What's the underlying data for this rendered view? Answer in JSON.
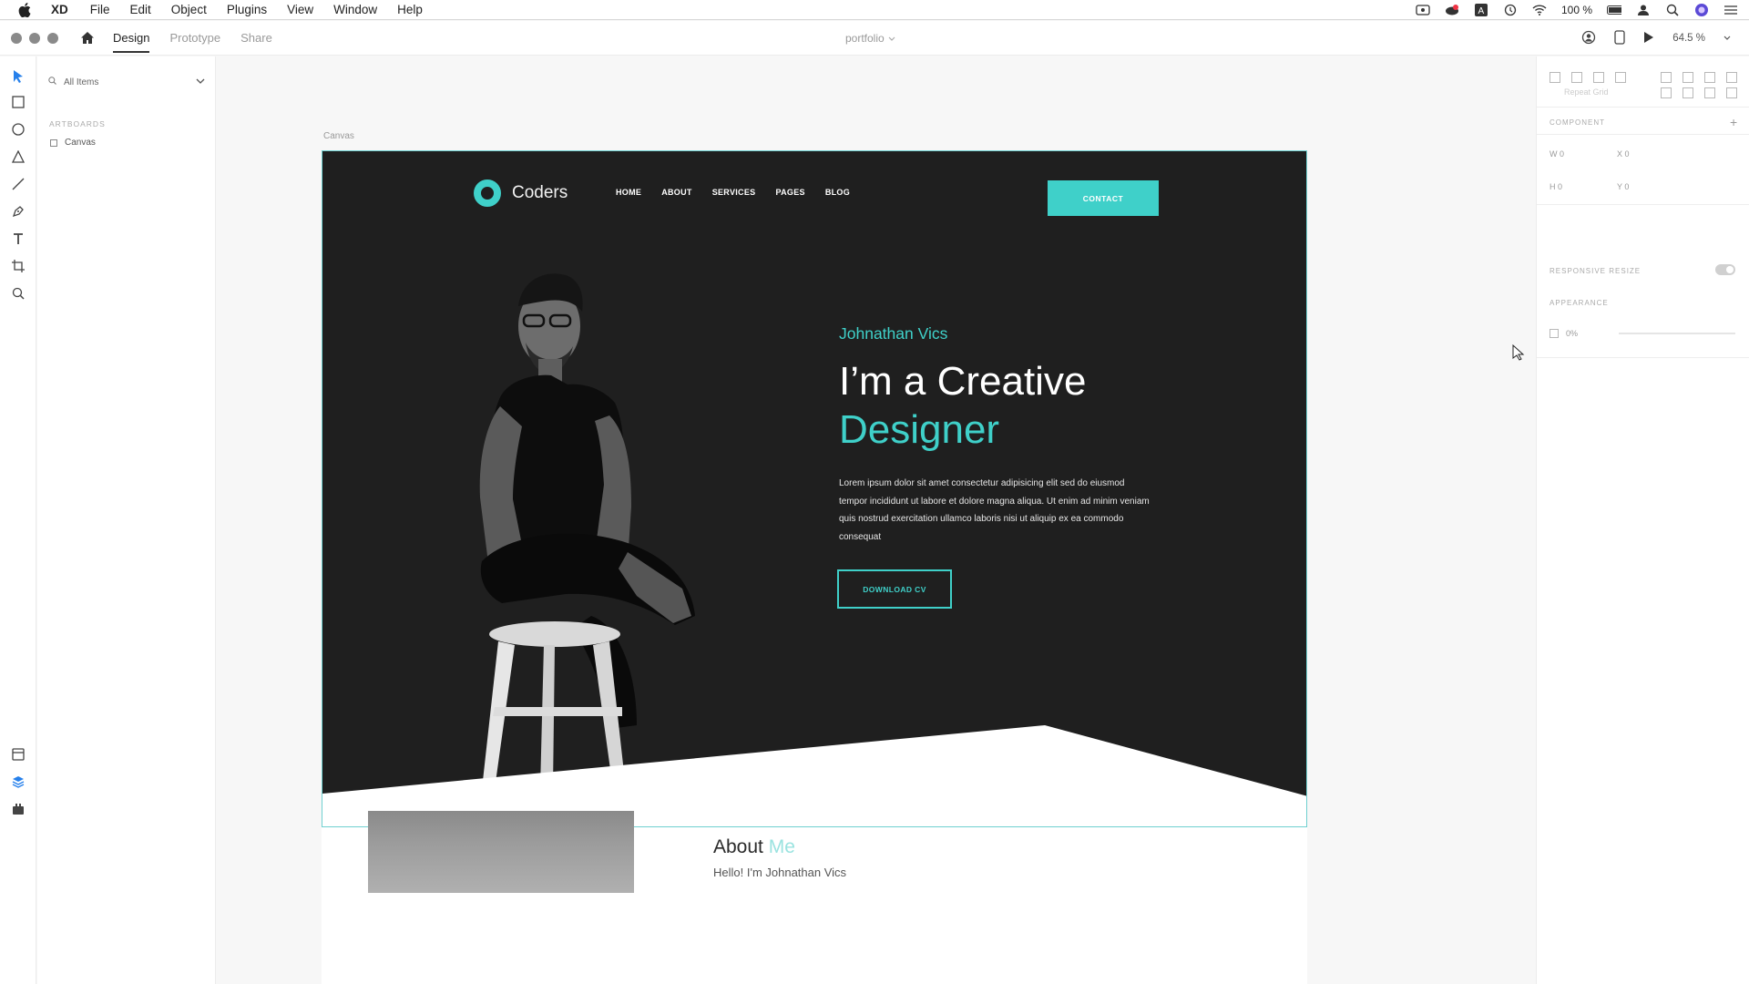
{
  "menubar": {
    "app": "XD",
    "items": [
      "File",
      "Edit",
      "Object",
      "Plugins",
      "View",
      "Window",
      "Help"
    ],
    "status": {
      "battery": "100 %"
    }
  },
  "titlebar": {
    "tabs": [
      "Design",
      "Prototype",
      "Share"
    ],
    "active_tab": "Design",
    "document": "portfolio",
    "zoom": "64.5 %"
  },
  "layers": {
    "search_placeholder": "All Items",
    "section": "ARTBOARDS",
    "items": [
      "Canvas"
    ]
  },
  "canvas": {
    "artboard_label": "Canvas",
    "nav": {
      "brand": "Coders",
      "links": [
        "HOME",
        "ABOUT",
        "SERVICES",
        "PAGES",
        "BLOG"
      ],
      "contact": "CONTACT"
    },
    "hero": {
      "name": "Johnathan Vics",
      "line1": "I’m a Creative",
      "line2": "Designer",
      "body": "Lorem ipsum dolor sit amet consectetur adipisicing elit sed do eiusmod tempor incididunt ut labore et dolore magna aliqua. Ut enim ad minim veniam quis nostrud exercitation ullamco laboris nisi ut aliquip ex ea commodo consequat",
      "download": "DOWNLOAD CV"
    },
    "about": {
      "title": "About",
      "title_accent": "Me",
      "subtitle": "Hello! I'm Johnathan Vics"
    }
  },
  "props": {
    "component": "COMPONENT",
    "w": "W  0",
    "x": "X  0",
    "h": "H  0",
    "y": "Y  0",
    "responsive": "RESPONSIVE RESIZE",
    "appearance": "APPEARANCE",
    "opacity": "0%",
    "repeat_grid": "Repeat Grid"
  },
  "colors": {
    "accent": "#3fd0c9",
    "hero_bg": "#1f1f1f"
  }
}
